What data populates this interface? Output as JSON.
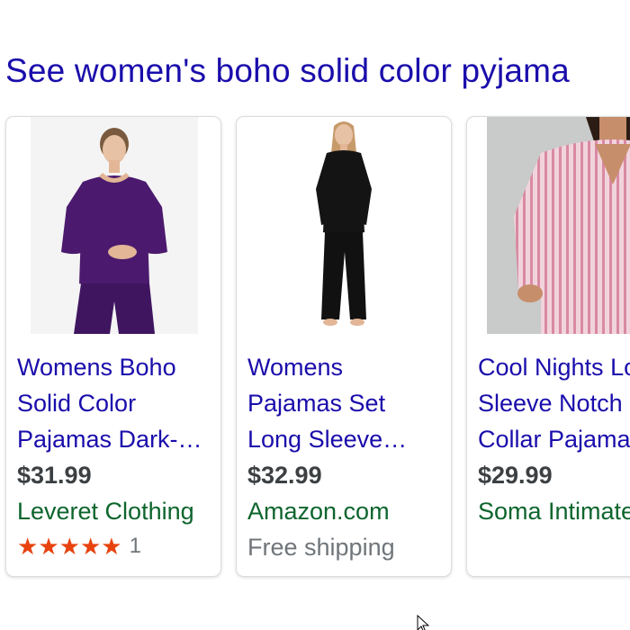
{
  "heading": "See women's boho solid color pyjama",
  "products": [
    {
      "title_lines": [
        "Womens Boho",
        "Solid Color",
        "Pajamas Dark-…"
      ],
      "price": "$31.99",
      "seller": "Leveret Clothing",
      "rating": {
        "stars": 5,
        "count": "1"
      },
      "image_icon": "purple-pajama-photo"
    },
    {
      "title_lines": [
        "Womens",
        "Pajamas Set",
        "Long Sleeve…"
      ],
      "price": "$32.99",
      "seller": "Amazon.com",
      "shipping": "Free shipping",
      "image_icon": "black-pajama-photo"
    },
    {
      "title_lines": [
        "Cool Nights Long",
        "Sleeve Notch",
        "Collar Pajama"
      ],
      "price": "$29.99",
      "seller": "Soma Intimates",
      "image_icon": "pink-striped-pajama-photo"
    }
  ],
  "colors": {
    "link": "#1a0dab",
    "seller": "#0d652d",
    "price": "#3c4043",
    "star": "#e8430f",
    "muted": "#70757a"
  }
}
